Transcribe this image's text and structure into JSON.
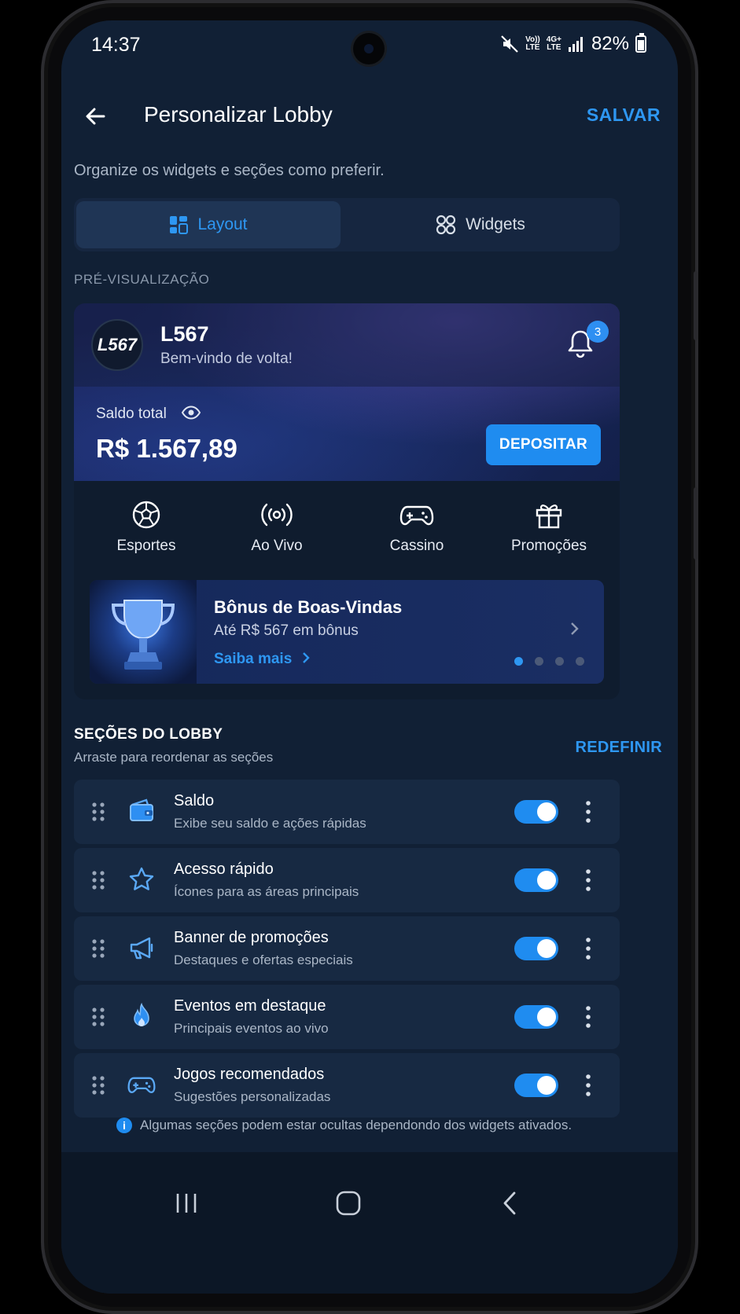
{
  "status": {
    "time": "14:37",
    "volte": "Vo))\nLTE",
    "net": "4G+\nLTE",
    "battery": "82%"
  },
  "header": {
    "title": "Personalizar Lobby",
    "save_label": "SALVAR"
  },
  "subtitle": "Organize os widgets e seções como preferir.",
  "tabs": [
    {
      "label": "Layout",
      "active": true
    },
    {
      "label": "Widgets",
      "active": false
    }
  ],
  "preview": {
    "label": "PRÉ-VISUALIZAÇÃO",
    "logo_text": "L567",
    "brand": "L567",
    "welcome": "Bem-vindo de volta!",
    "notification_count": "3",
    "balance_label": "Saldo total",
    "balance_value": "R$ 1.567,89",
    "deposit_label": "DEPOSITAR",
    "quick_access": [
      {
        "label": "Esportes",
        "icon": "soccer-ball-icon"
      },
      {
        "label": "Ao Vivo",
        "icon": "live-broadcast-icon"
      },
      {
        "label": "Cassino",
        "icon": "gamepad-icon"
      },
      {
        "label": "Promoções",
        "icon": "gift-icon"
      }
    ],
    "banner": {
      "title": "Bônus de Boas-Vindas",
      "subtitle": "Até R$ 567 em bônus",
      "link": "Saiba mais",
      "slides": 4,
      "active_slide": 1
    }
  },
  "lobby_sections": {
    "title": "SEÇÕES DO LOBBY",
    "subtitle": "Arraste para reordenar as seções",
    "reset_label": "REDEFINIR",
    "items": [
      {
        "name": "Saldo",
        "desc": "Exibe seu saldo e ações rápidas",
        "icon": "wallet-icon",
        "enabled": true
      },
      {
        "name": "Acesso rápido",
        "desc": "Ícones para as áreas principais",
        "icon": "star-icon",
        "enabled": true
      },
      {
        "name": "Banner de promoções",
        "desc": "Destaques e ofertas especiais",
        "icon": "megaphone-icon",
        "enabled": true
      },
      {
        "name": "Eventos em destaque",
        "desc": "Principais eventos ao vivo",
        "icon": "fire-icon",
        "enabled": true
      },
      {
        "name": "Jogos recomendados",
        "desc": "Sugestões personalizadas",
        "icon": "gamepad-icon",
        "enabled": true
      }
    ]
  },
  "footer_note": "Algumas seções podem estar ocultas dependondo dos widgets ativados.",
  "colors": {
    "accent": "#2e97f2",
    "background": "#112035",
    "card": "#172942"
  }
}
